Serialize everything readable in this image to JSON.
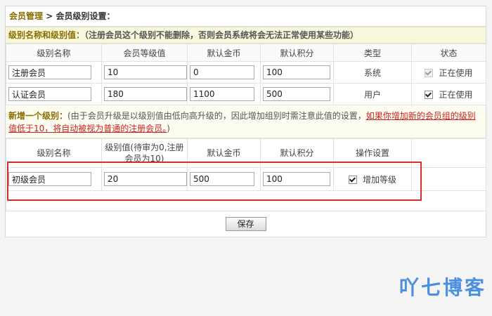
{
  "breadcrumb": {
    "parent": "会员管理",
    "separator": " > ",
    "current": "会员级别设置："
  },
  "existing_section": {
    "label": "级别名称和级别值：",
    "note": "（注册会员这个级别不能删除，否则会员系统将会无法正常使用某些功能）"
  },
  "existing_headers": [
    "级别名称",
    "会员等级值",
    "默认金币",
    "默认积分",
    "类型",
    "状态"
  ],
  "existing_rows": [
    {
      "name": "注册会员",
      "level": "10",
      "gold": "0",
      "points": "100",
      "type": "系统",
      "status": "正在使用",
      "checked": true,
      "disabled": true
    },
    {
      "name": "认证会员",
      "level": "180",
      "gold": "1100",
      "points": "500",
      "type": "用户",
      "status": "正在使用",
      "checked": true,
      "disabled": false
    }
  ],
  "new_section": {
    "label": "新增一个级别：",
    "note": "(由于会员升级是以级别值由低向高升级的，因此增加组别时需注意此值的设置，",
    "warning": "如果你增加新的会员组的级别值低于10，将自动被视为普通的注册会员。",
    "tail": ")"
  },
  "new_headers": [
    "级别名称",
    "级别值(待审为0,注册会员为10)",
    "默认金币",
    "默认积分",
    "操作设置"
  ],
  "new_row": {
    "name": "初级会员",
    "level": "20",
    "gold": "500",
    "points": "100",
    "action_label": "增加等级",
    "checked": true
  },
  "save_label": "保存",
  "watermark": "吖七博客",
  "colors": {
    "highlight": "#d92b2b",
    "accent": "#8a6d00",
    "warning": "#cc2222",
    "watermark": "#4a8fe0"
  }
}
